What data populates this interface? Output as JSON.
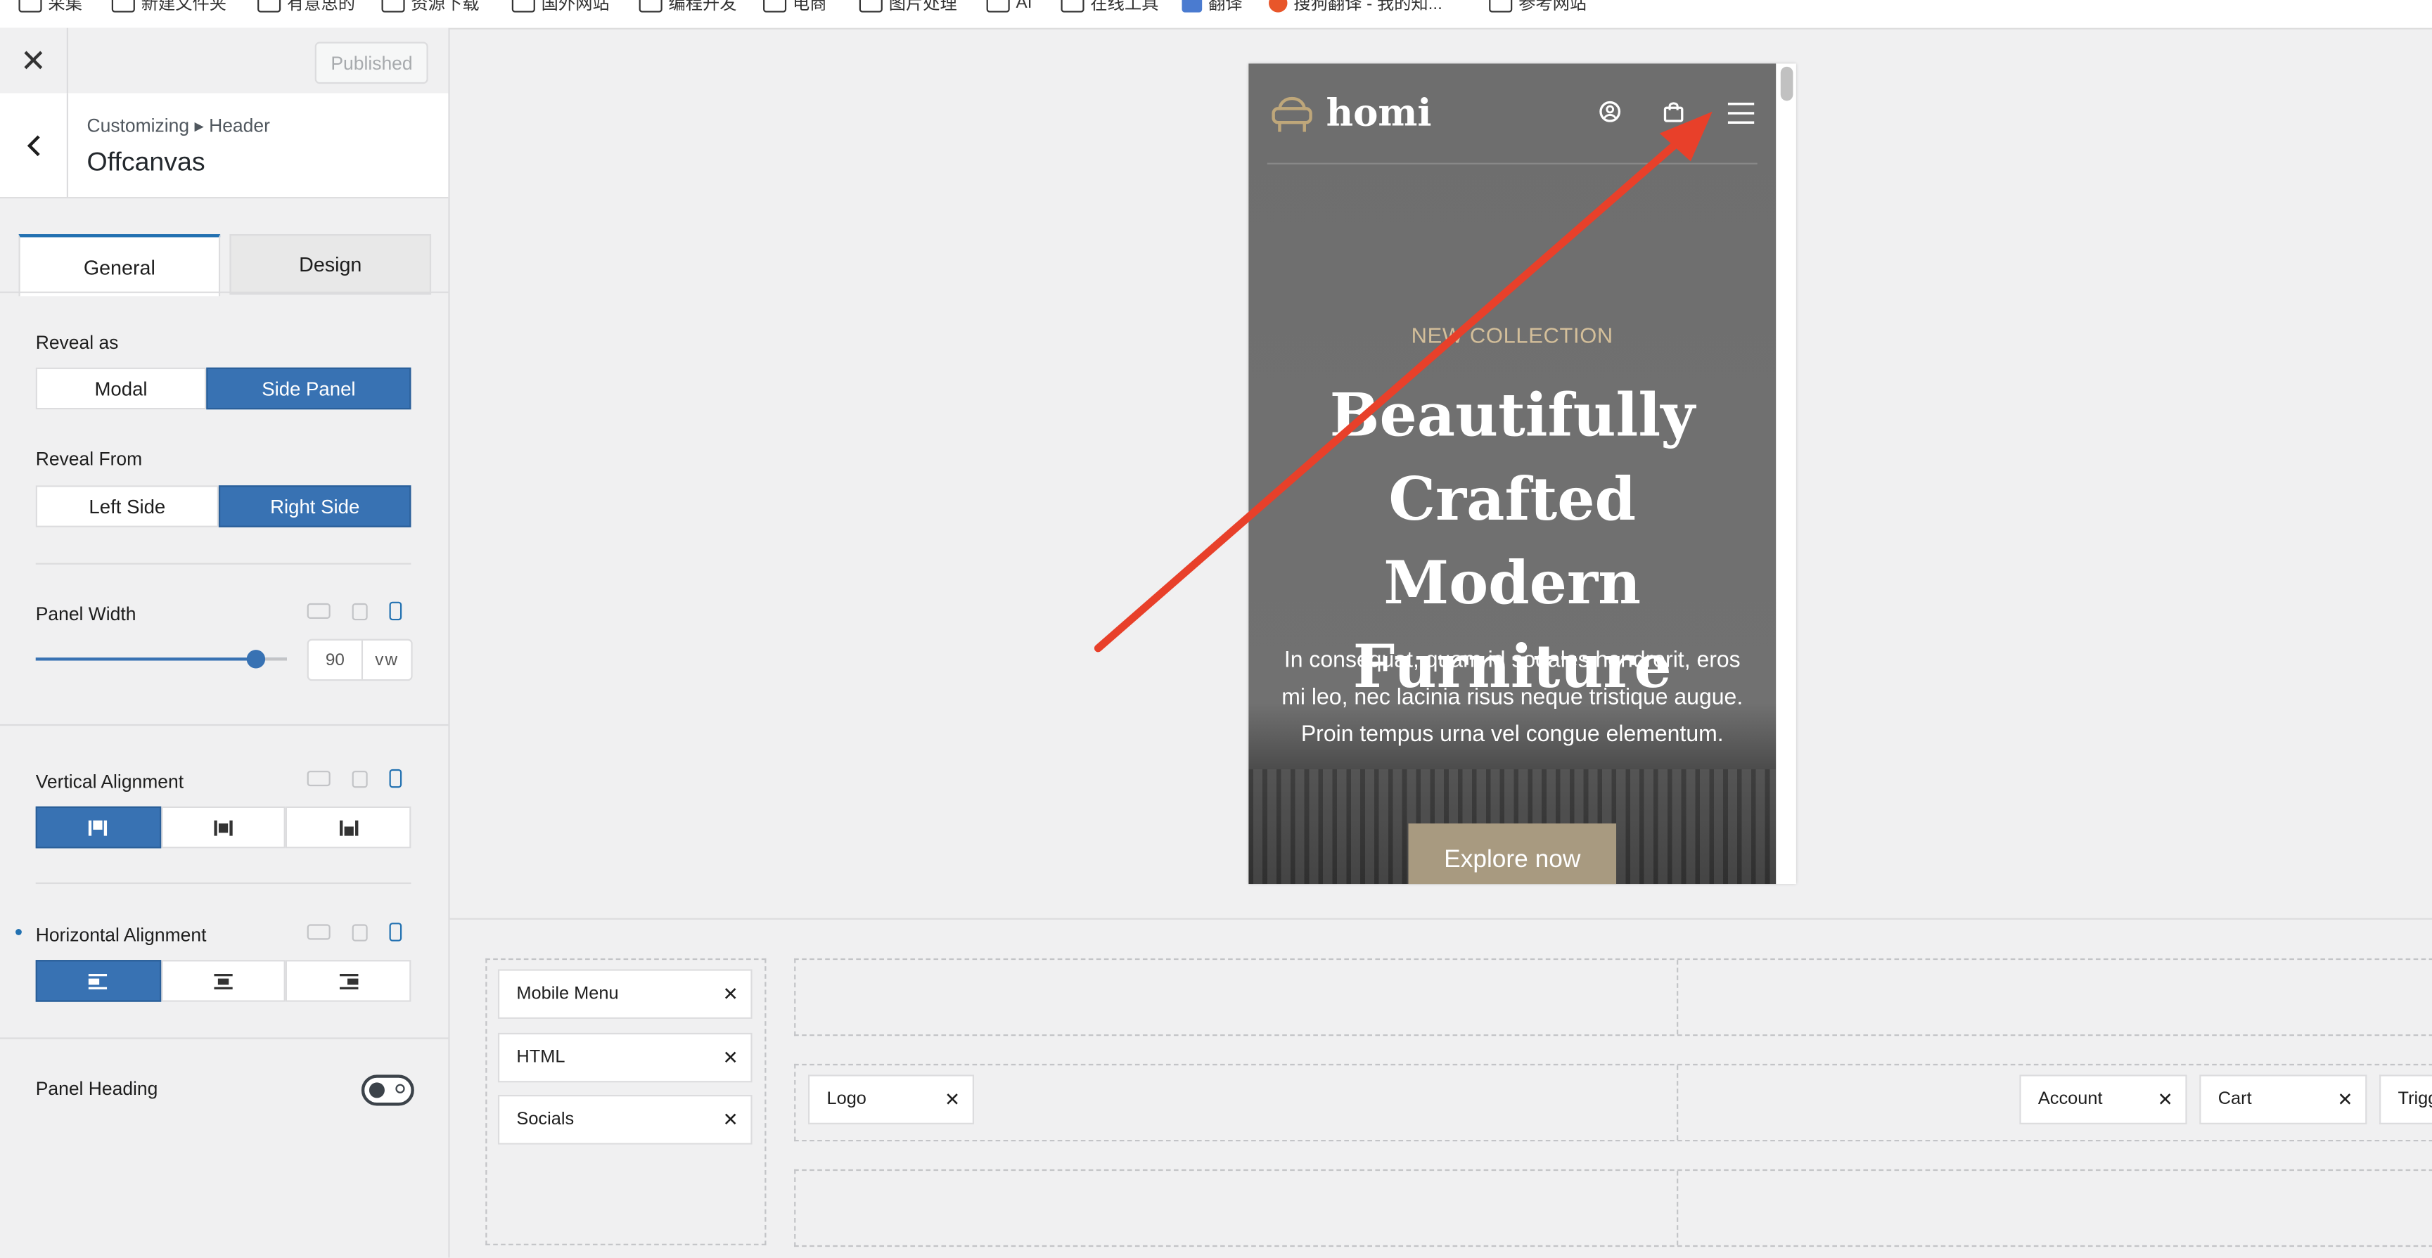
{
  "bookmarks": [
    "采集",
    "新建文件夹",
    "有意思的",
    "资源下载",
    "国外网站",
    "编程开发",
    "电商",
    "图片处理",
    "AI",
    "在线工具",
    "翻译",
    "搜狗翻译 - 我的知...",
    "参考网站"
  ],
  "sidebar": {
    "close_label": "✕",
    "publish_label": "Published",
    "breadcrumb": "Customizing ▸ Header",
    "title": "Offcanvas",
    "tabs": [
      "General",
      "Design"
    ],
    "reveal_as": {
      "label": "Reveal as",
      "options": [
        "Modal",
        "Side Panel"
      ],
      "selected": "Side Panel"
    },
    "reveal_from": {
      "label": "Reveal From",
      "options": [
        "Left Side",
        "Right Side"
      ],
      "selected": "Right Side"
    },
    "panel_width": {
      "label": "Panel Width",
      "value": "90",
      "unit": "vw",
      "slider_fraction": 0.9
    },
    "vertical_alignment": {
      "label": "Vertical Alignment",
      "selected_index": 0
    },
    "horizontal_alignment": {
      "label": "Horizontal Alignment",
      "selected_index": 0
    },
    "panel_heading": {
      "label": "Panel Heading",
      "enabled": false
    }
  },
  "preview": {
    "logo_text": "homi",
    "kicker": "NEW COLLECTION",
    "headline": "Beautifully Crafted Modern Furniture",
    "paragraph": "In consequat, quam id sodales hendrerit, eros mi leo, nec lacinia risus neque tristique augue. Proin tempus urna vel congue elementum.",
    "cta_label": "Explore now"
  },
  "builder": {
    "available": [
      "Mobile Menu",
      "HTML",
      "Socials"
    ],
    "middle_row_left": [
      "Logo"
    ],
    "middle_row_right": [
      "Account",
      "Cart",
      "Trigger"
    ]
  },
  "colors": {
    "accent": "#3872b3",
    "arrow": "#e8402a",
    "cta": "#a89a80",
    "kicker": "#d4bf9a"
  }
}
